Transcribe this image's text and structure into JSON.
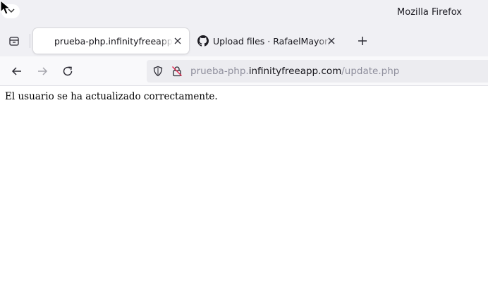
{
  "window": {
    "title": "Mozilla Firefox"
  },
  "tabs": [
    {
      "label": "prueba-php.infinityfreeapp.com/update.php",
      "favicon": "blank-page-icon",
      "active": true
    },
    {
      "label": "Upload files · RafaelMayor/D",
      "favicon": "github-icon",
      "active": false
    }
  ],
  "navbar": {
    "url_host_prefix": "prueba-php.",
    "url_domain": "infinityfreeapp.com",
    "url_path": "/update.php"
  },
  "page": {
    "message": "El usuario se ha actualizado correctamente."
  },
  "colors": {
    "chrome_bg": "#f0f0f4",
    "navbar_bg": "#f9f9fb",
    "urlbar_bg": "#ececf0",
    "text": "#15141a",
    "dim_text": "#8f8f9d"
  }
}
